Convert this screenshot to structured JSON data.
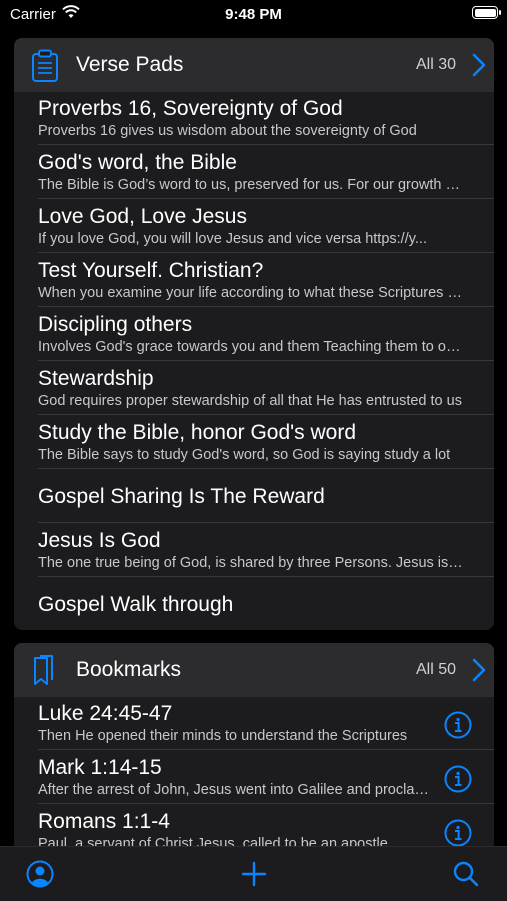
{
  "status_bar": {
    "carrier": "Carrier",
    "time": "9:48 PM"
  },
  "verse_pads": {
    "title": "Verse Pads",
    "count_label": "All 30",
    "icon": "clipboard-icon",
    "items": [
      {
        "title": "Proverbs 16, Sovereignty of God",
        "subtitle": "Proverbs 16 gives us wisdom about the sovereignty of God"
      },
      {
        "title": "God's word, the Bible",
        "subtitle": "The Bible is God’s word to us, preserved for us. For our growth and understanding"
      },
      {
        "title": "Love God, Love Jesus",
        "subtitle": "If you love God, you will love Jesus and vice versa     https://y..."
      },
      {
        "title": "Test Yourself. Christian?",
        "subtitle": "When you examine your life according to what these Scriptures say"
      },
      {
        "title": "Discipling others",
        "subtitle": "Involves    God's grace towards you and them  Teaching them to obey"
      },
      {
        "title": "Stewardship",
        "subtitle": "God requires proper stewardship of all that He has entrusted to us"
      },
      {
        "title": "Study the Bible, honor God's word",
        "subtitle": "The Bible says to study God's word, so God is saying study a lot"
      },
      {
        "title": "Gospel Sharing Is The Reward",
        "subtitle": ""
      },
      {
        "title": "Jesus Is God",
        "subtitle": "The one true being of God, is shared by three Persons. Jesus is God"
      },
      {
        "title": "Gospel Walk through",
        "subtitle": ""
      }
    ]
  },
  "bookmarks": {
    "title": "Bookmarks",
    "count_label": "All 50",
    "icon": "bookmark-icon",
    "items": [
      {
        "title": "Luke 24:45-47",
        "subtitle": "Then He opened their minds to understand the Scriptures"
      },
      {
        "title": "Mark 1:14-15",
        "subtitle": "After the arrest of John, Jesus went into Galilee and proclaimed"
      },
      {
        "title": "Romans 1:1-4",
        "subtitle": "Paul, a servant of Christ Jesus, called to be an apostle"
      }
    ]
  },
  "tab_bar": {
    "items": [
      "profile-icon",
      "add-icon",
      "search-icon"
    ]
  },
  "colors": {
    "accent": "#0a84ff",
    "card_bg": "#1c1c1e",
    "header_bg": "#2c2c2e"
  }
}
